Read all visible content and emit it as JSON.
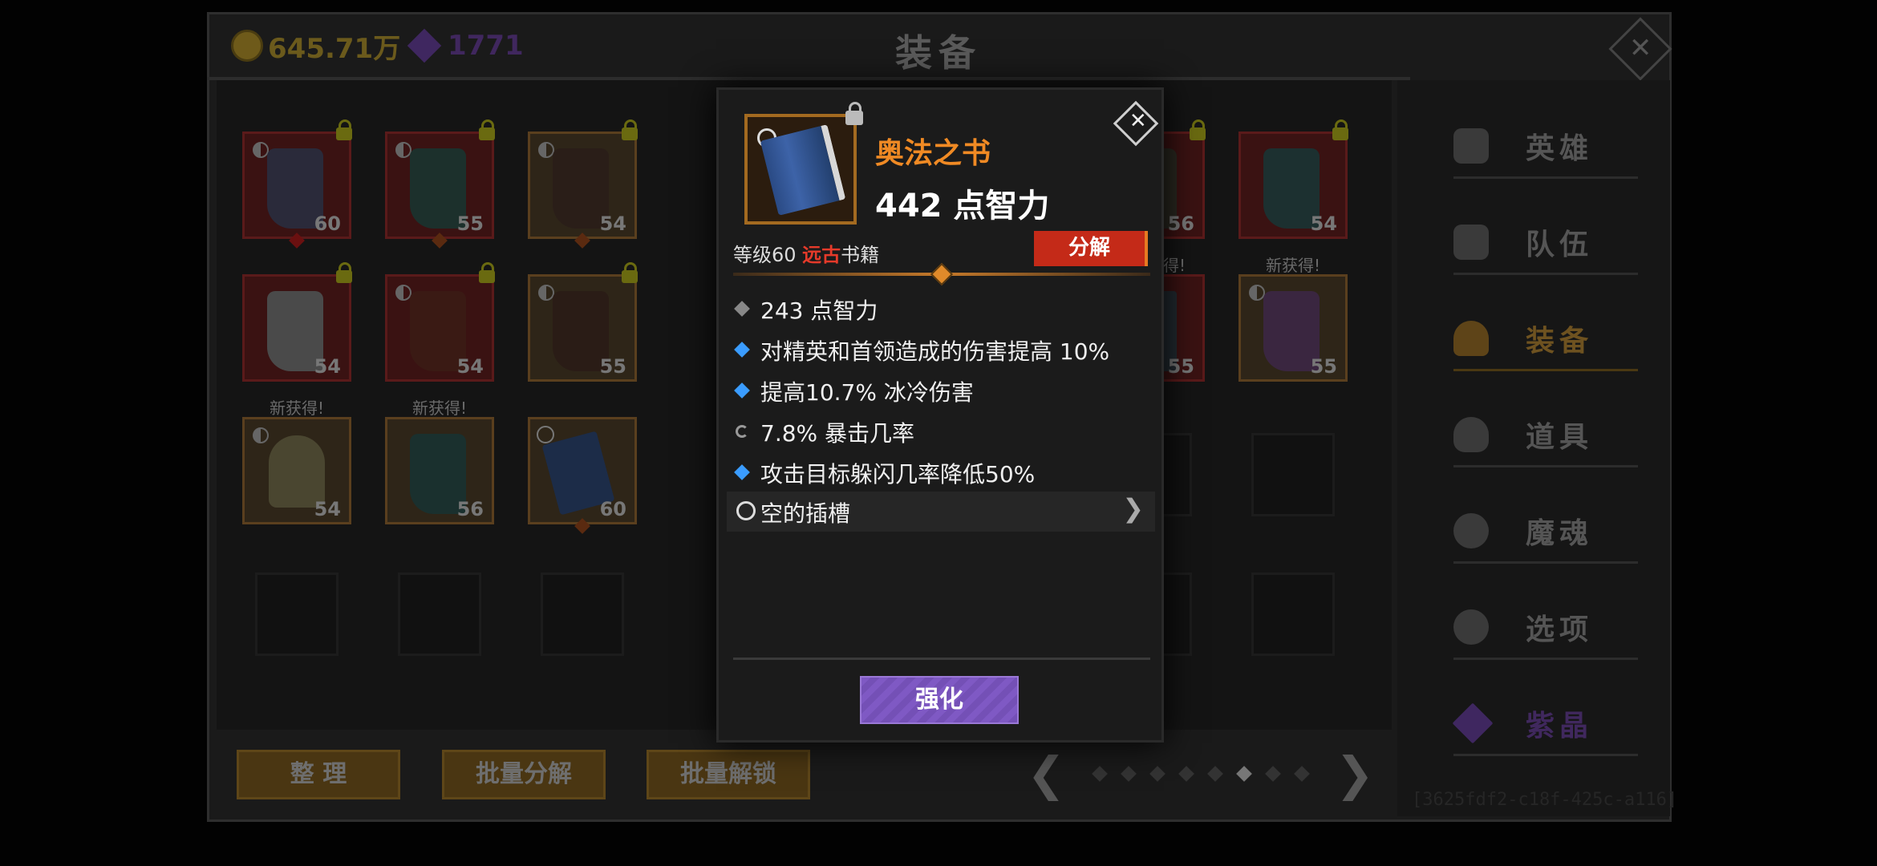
{
  "header": {
    "gold": "645.71万",
    "crystals": "1771",
    "title": "装备",
    "gold_color": "#6b5a1c",
    "crystal_color": "#40275e"
  },
  "grid": {
    "row1": [
      {
        "level": "60",
        "kind": "boots",
        "rarity": "red",
        "lock": true,
        "yin": true,
        "dot": true
      },
      {
        "level": "55",
        "kind": "boots",
        "rarity": "red",
        "lock": true,
        "yin": true,
        "dot": true
      },
      {
        "level": "54",
        "kind": "boots",
        "rarity": "orange",
        "lock": true,
        "yin": true,
        "dot": true
      },
      {
        "level": "56",
        "kind": "boots",
        "rarity": "red",
        "lock": true,
        "yin": true,
        "dot": false
      },
      {
        "level": "54",
        "kind": "boots",
        "rarity": "red",
        "lock": true,
        "yin": false,
        "dot": false
      }
    ],
    "row2": [
      {
        "level": "54",
        "kind": "boots",
        "rarity": "red",
        "lock": true,
        "yin": false
      },
      {
        "level": "54",
        "kind": "boots",
        "rarity": "red",
        "lock": true,
        "yin": true
      },
      {
        "level": "55",
        "kind": "boots",
        "rarity": "orange",
        "lock": true,
        "yin": true
      },
      {
        "level": "55",
        "kind": "weapon",
        "rarity": "red",
        "lock": false,
        "yin": false,
        "new_label": "得!"
      },
      {
        "level": "55",
        "kind": "boots",
        "rarity": "orange",
        "lock": false,
        "yin": true,
        "new_label": "新获得!"
      }
    ],
    "row3": [
      {
        "level": "54",
        "kind": "helmet",
        "rarity": "orange",
        "new_label": "新获得!",
        "yin": true
      },
      {
        "level": "56",
        "kind": "boots",
        "rarity": "orange",
        "new_label": "新获得!",
        "yin": false
      },
      {
        "level": "60",
        "kind": "book",
        "rarity": "orange",
        "ring": true,
        "dot": true
      }
    ]
  },
  "buttons": {
    "sort": "整 理",
    "batch_dismantle": "批量分解",
    "batch_unlock": "批量解锁"
  },
  "pager": {
    "prev": "❮",
    "next": "❯",
    "pages": 8,
    "active_page": 6
  },
  "footer_id": "[3625fdf2-c18f-425c-a116]",
  "menu": {
    "items": [
      {
        "label": "英雄",
        "icon": "heroes-icon"
      },
      {
        "label": "队伍",
        "icon": "flag-icon"
      },
      {
        "label": "装备",
        "icon": "helmet-icon",
        "active": true
      },
      {
        "label": "道具",
        "icon": "bag-icon"
      },
      {
        "label": "魔魂",
        "icon": "flame-icon"
      },
      {
        "label": "选项",
        "icon": "gear-icon"
      },
      {
        "label": "紫晶",
        "icon": "crystal-icon"
      }
    ]
  },
  "popup": {
    "name": "奥法之书",
    "main_stat": "442 点智力",
    "level_prefix": "等级60 ",
    "rarity": "远古",
    "category": "书籍",
    "dismantle": "分解",
    "attributes": [
      {
        "bullet": "grey",
        "text": "243 点智力"
      },
      {
        "bullet": "blue",
        "text": "对精英和首领造成的伤害提高 10%"
      },
      {
        "bullet": "blue",
        "text": "提高10.7% 冰冷伤害"
      },
      {
        "bullet": "cycle",
        "text": "7.8% 暴击几率"
      },
      {
        "bullet": "blue",
        "text": "攻击目标躲闪几率降低50%"
      }
    ],
    "socket": "空的插槽",
    "enhance": "强化",
    "name_color": "#f08a24",
    "rarity_color": "#e53a2a",
    "enhance_color": "#7f59c4"
  }
}
